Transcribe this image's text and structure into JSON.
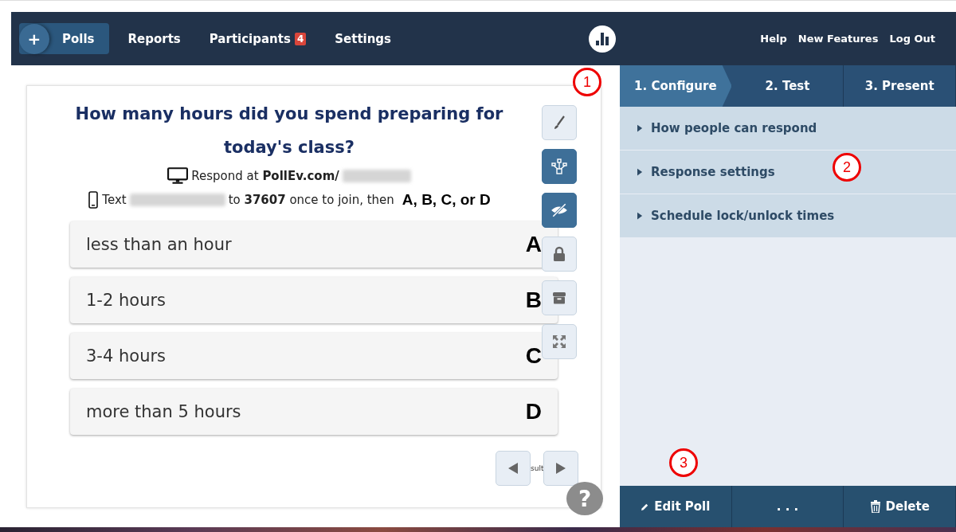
{
  "nav": {
    "add_button": "+",
    "items": [
      {
        "label": "Polls",
        "selected": true
      },
      {
        "label": "Reports",
        "selected": false
      },
      {
        "label": "Participants",
        "selected": false,
        "badge": "4"
      },
      {
        "label": "Settings",
        "selected": false
      }
    ],
    "right_links": [
      "Help",
      "New Features",
      "Log Out"
    ]
  },
  "poll": {
    "question": "How many hours did you spend preparing for today's class?",
    "respond_line": "Respond at **PollEv.com/**",
    "text_prefix": "Text",
    "text_suffix": "to **37607** once to join, then",
    "choices_hint": "A, B, C, or D",
    "options": [
      {
        "text": "less than an hour",
        "letter": "A"
      },
      {
        "text": "1-2 hours",
        "letter": "B"
      },
      {
        "text": "3-4 hours",
        "letter": "C"
      },
      {
        "text": "more than 5 hours",
        "letter": "D"
      }
    ],
    "tools": [
      {
        "kind": "brush",
        "on": false
      },
      {
        "kind": "network",
        "on": true
      },
      {
        "kind": "hide",
        "on": true
      },
      {
        "kind": "lock",
        "on": false
      },
      {
        "kind": "archive",
        "on": false
      },
      {
        "kind": "fullscreen",
        "on": false
      }
    ],
    "results_label": "sult",
    "help": "?"
  },
  "steps": [
    {
      "label": "1. Configure",
      "selected": true
    },
    {
      "label": "2. Test",
      "selected": false
    },
    {
      "label": "3. Present",
      "selected": false
    }
  ],
  "accordion": [
    {
      "label": "How people can respond",
      "expanded": false
    },
    {
      "label": "Response settings",
      "expanded": false
    },
    {
      "label": "Schedule lock/unlock times",
      "expanded": false
    }
  ],
  "actions": [
    {
      "kind": "edit",
      "label": "Edit Poll"
    },
    {
      "kind": "more",
      "label": ". . ."
    },
    {
      "kind": "delete",
      "label": "Delete"
    }
  ],
  "annotations": [
    "1",
    "2",
    "3"
  ]
}
